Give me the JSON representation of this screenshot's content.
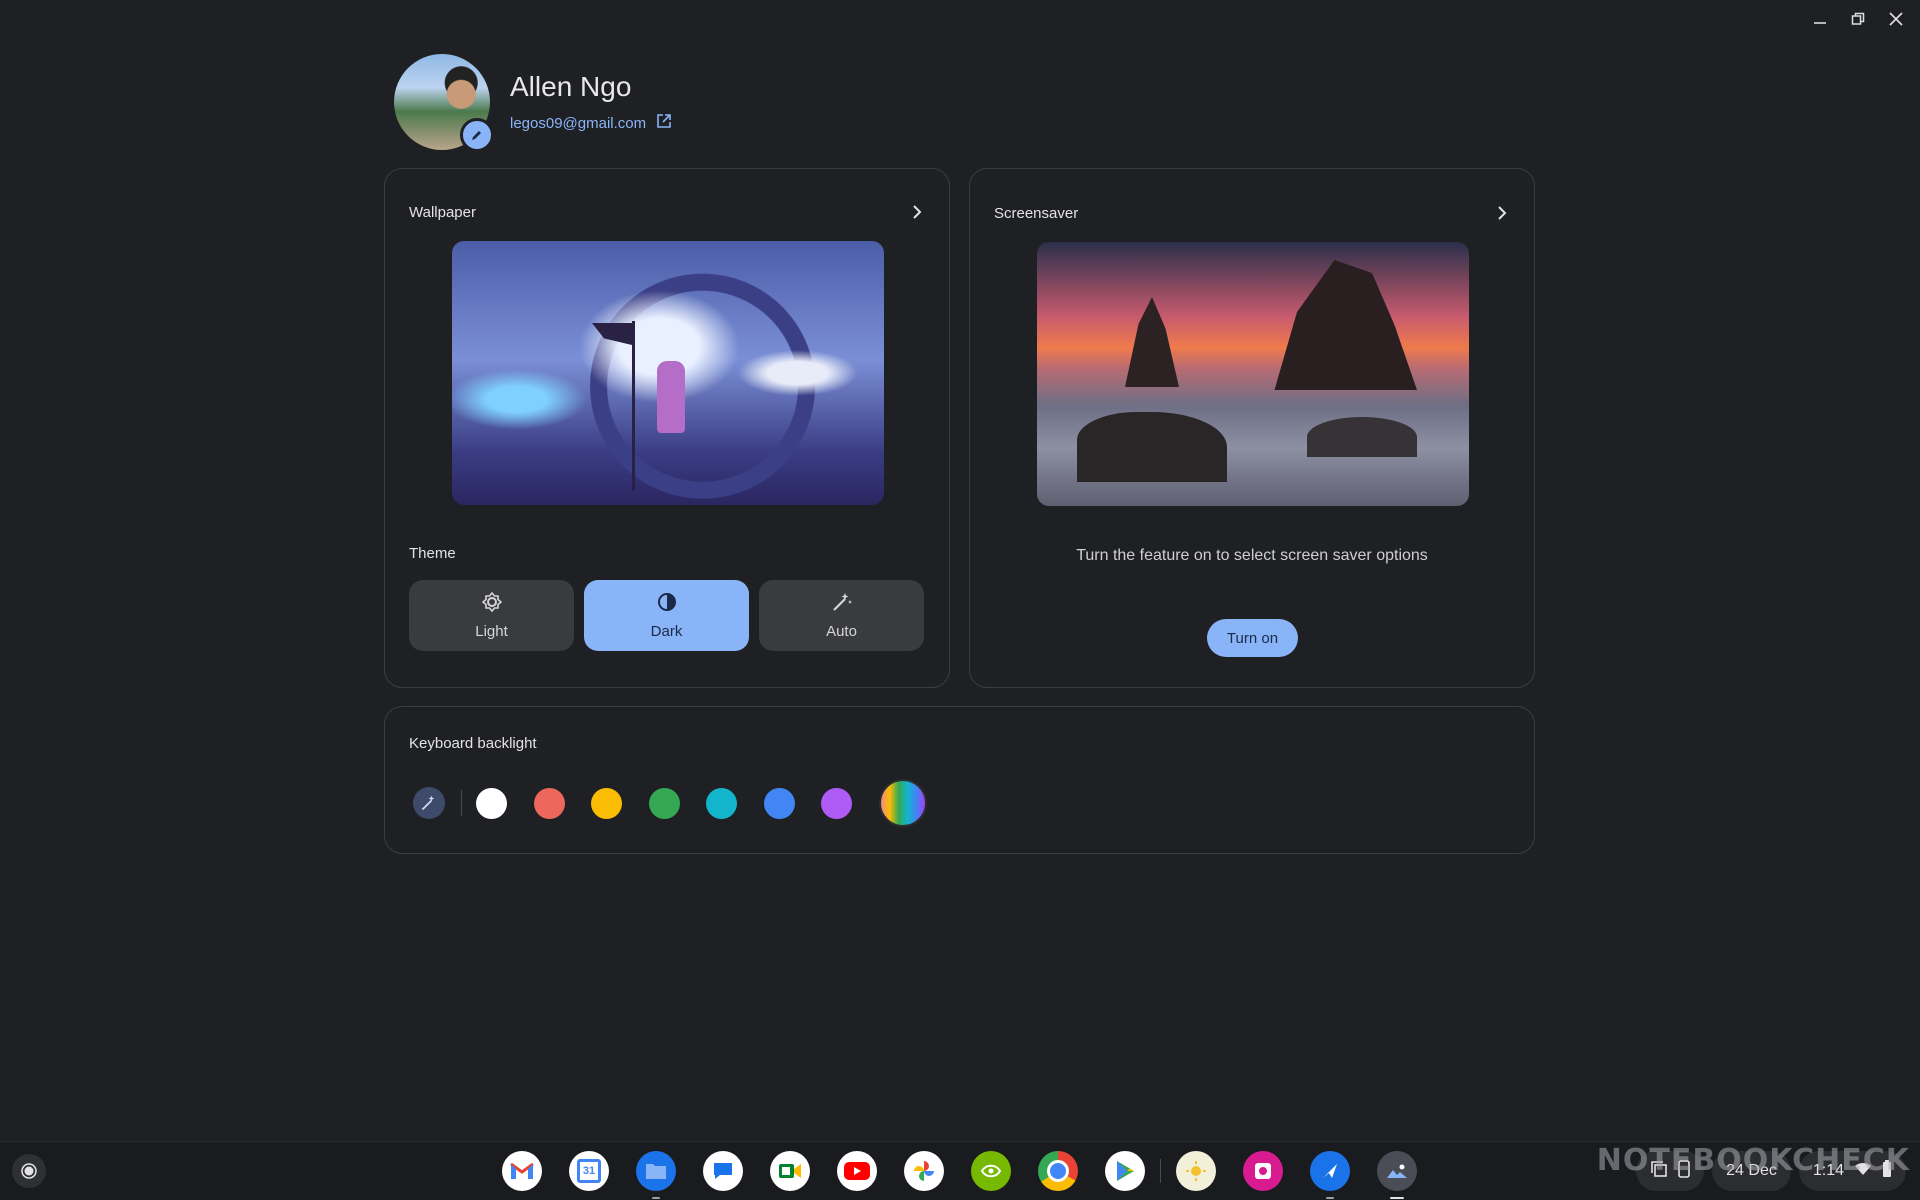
{
  "profile": {
    "name": "Allen Ngo",
    "email": "legos09@gmail.com"
  },
  "wallpaper": {
    "title": "Wallpaper"
  },
  "theme": {
    "title": "Theme",
    "options": [
      {
        "label": "Light",
        "icon": "brightness-icon"
      },
      {
        "label": "Dark",
        "icon": "contrast-icon",
        "selected": true
      },
      {
        "label": "Auto",
        "icon": "magic-wand-icon"
      }
    ]
  },
  "screensaver": {
    "title": "Screensaver",
    "message": "Turn the feature on to select screen saver options",
    "button_label": "Turn on"
  },
  "keyboard_backlight": {
    "title": "Keyboard backlight",
    "colors": [
      "#ffffff",
      "#ee675c",
      "#fbbc04",
      "#34a853",
      "#12b5cb",
      "#4285f4",
      "#af5cf7"
    ]
  },
  "shelf": {
    "calendar_day": "31",
    "date": "24 Dec",
    "time": "1:14"
  },
  "watermark": "NOTEBOOKCHECK",
  "colors": {
    "accent": "#8ab4f8",
    "background": "#1f2023",
    "card_border": "#3c3d41"
  }
}
